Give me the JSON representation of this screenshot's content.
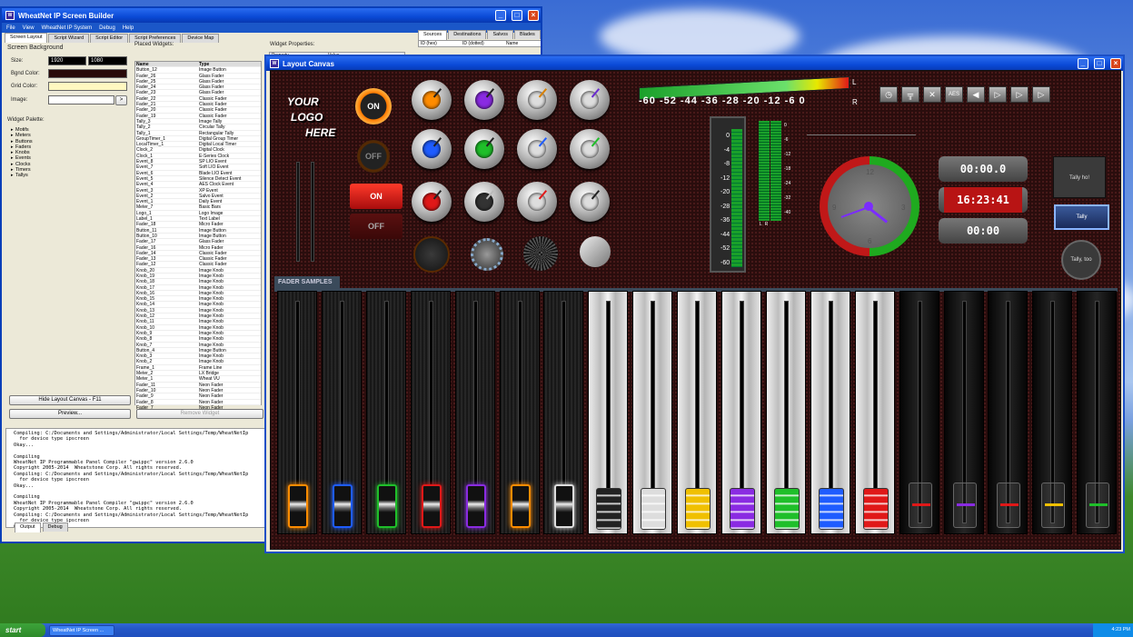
{
  "builder": {
    "title": "WheatNet IP Screen Builder",
    "menu": [
      "File",
      "View",
      "WheatNet IP System",
      "Debug",
      "Help"
    ],
    "tabs": [
      "Screen Layout",
      "Script Wizard",
      "Script Editor",
      "Script Preferences",
      "Device Map"
    ],
    "screen_background": "Screen Background",
    "size_label": "Size:",
    "size_w": "1920",
    "size_h": "1080",
    "bgnd_label": "Bgnd Color:",
    "grid_label": "Grid Color:",
    "image_label": "Image:",
    "image_btn": ">",
    "palette_label": "Widget Palette:",
    "palette": [
      "Motifs",
      "Meters",
      "Buttons",
      "Faders",
      "Knobs",
      "Events",
      "Clocks",
      "Timers",
      "Tallys"
    ],
    "placed_label": "Placed Widgets:",
    "props_label": "Widget Properties:",
    "col_name": "Name",
    "col_type": "Type",
    "prop_col1": "Property",
    "prop_col2": "Value",
    "widgets": [
      [
        "Button_12",
        "Image Button"
      ],
      [
        "Fader_26",
        "Glass Fader"
      ],
      [
        "Fader_25",
        "Glass Fader"
      ],
      [
        "Fader_24",
        "Glass Fader"
      ],
      [
        "Fader_23",
        "Glass Fader"
      ],
      [
        "Fader_22",
        "Classic Fader"
      ],
      [
        "Fader_21",
        "Classic Fader"
      ],
      [
        "Fader_20",
        "Classic Fader"
      ],
      [
        "Fader_19",
        "Classic Fader"
      ],
      [
        "Tally_3",
        "Image Tally"
      ],
      [
        "Tally_2",
        "Circular Tally"
      ],
      [
        "Tally_1",
        "Rectangular Tally"
      ],
      [
        "GroupTimer_1",
        "Digital Group Timer"
      ],
      [
        "LocalTimer_1",
        "Digital Local Timer"
      ],
      [
        "Clock_2",
        "Digital Clock"
      ],
      [
        "Clock_1",
        "E-Series Clock"
      ],
      [
        "Event_8",
        "SP LIO Event"
      ],
      [
        "Event_7",
        "Soft LIO Event"
      ],
      [
        "Event_6",
        "Blade LIO Event"
      ],
      [
        "Event_5",
        "Silence Detect Event"
      ],
      [
        "Event_4",
        "AES Clock Event"
      ],
      [
        "Event_3",
        "XP Event"
      ],
      [
        "Event_2",
        "Salvo Event"
      ],
      [
        "Event_1",
        "Daily Event"
      ],
      [
        "Meter_7",
        "Basic Bars"
      ],
      [
        "Logo_1",
        "Logo Image"
      ],
      [
        "Label_1",
        "Text Label"
      ],
      [
        "Fader_18",
        "Micro Fader"
      ],
      [
        "Button_11",
        "Image Button"
      ],
      [
        "Button_10",
        "Image Button"
      ],
      [
        "Fader_17",
        "Glass Fader"
      ],
      [
        "Fader_16",
        "Micro Fader"
      ],
      [
        "Fader_14",
        "Classic Fader"
      ],
      [
        "Fader_13",
        "Classic Fader"
      ],
      [
        "Fader_12",
        "Classic Fader"
      ],
      [
        "Knob_20",
        "Image Knob"
      ],
      [
        "Knob_19",
        "Image Knob"
      ],
      [
        "Knob_18",
        "Image Knob"
      ],
      [
        "Knob_17",
        "Image Knob"
      ],
      [
        "Knob_16",
        "Image Knob"
      ],
      [
        "Knob_15",
        "Image Knob"
      ],
      [
        "Knob_14",
        "Image Knob"
      ],
      [
        "Knob_13",
        "Image Knob"
      ],
      [
        "Knob_12",
        "Image Knob"
      ],
      [
        "Knob_11",
        "Image Knob"
      ],
      [
        "Knob_10",
        "Image Knob"
      ],
      [
        "Knob_9",
        "Image Knob"
      ],
      [
        "Knob_8",
        "Image Knob"
      ],
      [
        "Knob_7",
        "Image Knob"
      ],
      [
        "Button_4",
        "Image Button"
      ],
      [
        "Knob_3",
        "Image Knob"
      ],
      [
        "Knob_2",
        "Image Knob"
      ],
      [
        "Frame_1",
        "Frame Line"
      ],
      [
        "Meter_2",
        "LX Bridge"
      ],
      [
        "Meter_1",
        "Wheat VU"
      ],
      [
        "Fader_11",
        "Neon Fader"
      ],
      [
        "Fader_10",
        "Neon Fader"
      ],
      [
        "Fader_9",
        "Neon Fader"
      ],
      [
        "Fader_8",
        "Neon Fader"
      ],
      [
        "Fader_7",
        "Neon Fader"
      ]
    ],
    "hide_btn": "Hide Layout Canvas - F11",
    "preview_btn": "Preview...",
    "remove_btn": "Remove Widget",
    "output_tabs": [
      "Output",
      "Debug"
    ],
    "output": "Compiling: C:/Documents and Settings/Administrator/Local Settings/Temp/WheatNetIp\n  for device type ipscreen\nOkay...\n\nCompiling\nWheatNet IP Programmable Panel Compiler \"gwippc\" version 2.6.0\nCopyright 2005-2014  Wheatstone Corp. All rights reserved.\nCompiling: C:/Documents and Settings/Administrator/Local Settings/Temp/WheatNetIp\n  for device type ipscreen\nOkay...\n\nCompiling\nWheatNet IP Programmable Panel Compiler \"gwippc\" version 2.6.0\nCopyright 2005-2014  Wheatstone Corp. All rights reserved.\nCompiling: C:/Documents and Settings/Administrator/Local Settings/Temp/WheatNetIp\n  for device type ipscreen\nOkay..."
  },
  "sources": {
    "tabs": [
      "Sources",
      "Destinations",
      "Salvos",
      "Blades"
    ],
    "cols": [
      "ID (hex)",
      "ID (dotted)",
      "Name"
    ]
  },
  "canvas": {
    "title": "Layout Canvas",
    "logo": [
      "YOUR",
      "LOGO",
      "HERE"
    ],
    "on": "ON",
    "off": "OFF",
    "meter_scale": "-60 -52 -44 -36 -28 -20 -12 -6 0",
    "meter_L": "L",
    "meter_R": "R",
    "vu_ticks": [
      "0",
      "-4",
      "-8",
      "-12",
      "-20",
      "-28",
      "-36",
      "-44",
      "-52",
      "-60"
    ],
    "vu_lr": [
      "L",
      "R"
    ],
    "bars_ticks": [
      "0",
      "-6",
      "-12",
      "-18",
      "-24",
      "-32",
      "-40"
    ],
    "clock_nums": [
      "12",
      "1",
      "2",
      "3",
      "4",
      "5",
      "6",
      "7",
      "8",
      "9",
      "10",
      "11"
    ],
    "timer1": "00:00.0",
    "time": "16:23:41",
    "timer2": "00:00",
    "tally1": "Tally ho!",
    "tally2": "Tally",
    "tally3": "Tally, too",
    "aes": "AES",
    "fader_label": "FADER SAMPLES",
    "colors": {
      "orange": "#ff8c00",
      "blue": "#1e5cff",
      "green": "#1fbf2a",
      "red": "#e01818",
      "purple": "#8a2be2",
      "yellow": "#f0c000",
      "white": "#dddddd",
      "black": "#222222"
    }
  },
  "taskbar": {
    "start": "start",
    "item": "WheatNet IP Screen ...",
    "time": "4:23 PM"
  }
}
